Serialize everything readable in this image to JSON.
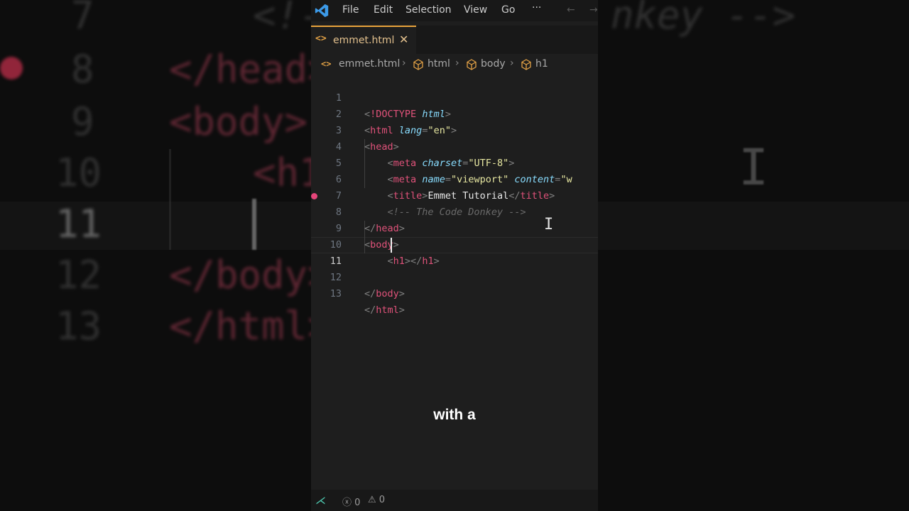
{
  "menu": [
    "File",
    "Edit",
    "Selection",
    "View",
    "Go",
    "···"
  ],
  "nav": {
    "back": "←",
    "forward": "→"
  },
  "tab": {
    "icon": "<>",
    "label": "emmet.html",
    "close": "✕"
  },
  "breadcrumb": {
    "file": "emmet.html",
    "items": [
      "html",
      "body",
      "h1"
    ]
  },
  "code": {
    "active_line": 11,
    "lines": [
      {
        "n": "1"
      },
      {
        "n": "2"
      },
      {
        "n": "3"
      },
      {
        "n": "4"
      },
      {
        "n": "5"
      },
      {
        "n": "6"
      },
      {
        "n": "7"
      },
      {
        "n": "8"
      },
      {
        "n": "9"
      },
      {
        "n": "10"
      },
      {
        "n": "11"
      },
      {
        "n": "12"
      },
      {
        "n": "13"
      }
    ],
    "text": {
      "doctype_kw": "!DOCTYPE",
      "doctype_val": "html",
      "html": "html",
      "lang": "lang",
      "lang_val": "\"en\"",
      "head": "head",
      "meta": "meta",
      "charset": "charset",
      "charset_val": "\"UTF-8\"",
      "name": "name",
      "name_val": "\"viewport\"",
      "content": "content",
      "content_val": "\"w",
      "title": "title",
      "title_text": "Emmet Tutorial",
      "comment": "<!-- The Code Donkey -->",
      "body": "body",
      "h1": "h1"
    }
  },
  "caption": "with a",
  "status": {
    "errors": "0",
    "warnings": "0"
  },
  "background": {
    "lines": [
      "7",
      "8",
      "9",
      "10",
      "11",
      "12",
      "13"
    ],
    "frag_head": "</head>",
    "frag_body": "<body>",
    "frag_h1": "<h1",
    "frag_body_close": "</body>",
    "frag_html_close": "</html>",
    "frag_comment_start": "<!-",
    "frag_comment_end": "nkey -->"
  },
  "colors": {
    "tag": "#e0527a",
    "attr": "#89ddff",
    "string": "#e6e6a0",
    "accent": "#e8a33c"
  }
}
